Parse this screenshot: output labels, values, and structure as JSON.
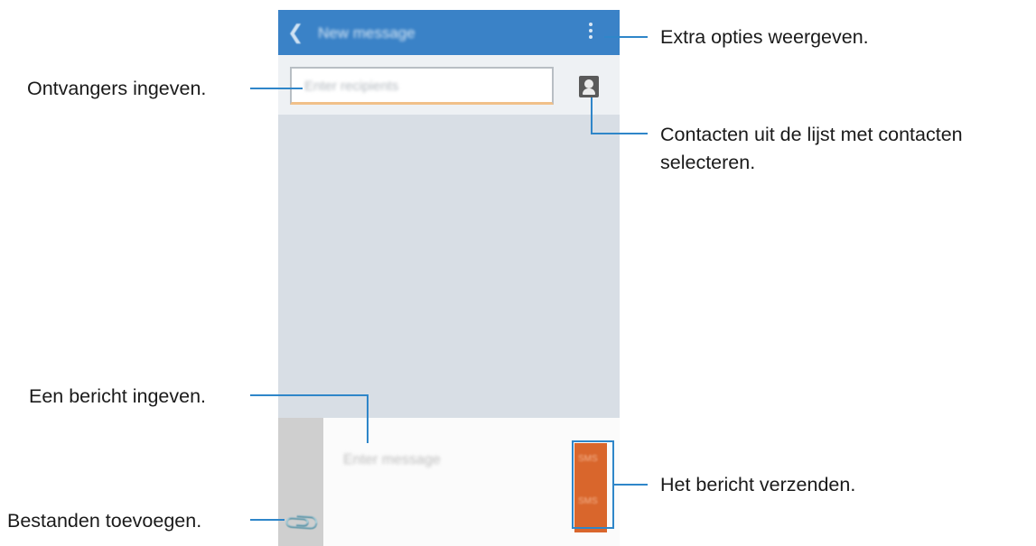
{
  "phone": {
    "app_title": "New message",
    "recipient_placeholder": "Enter recipients",
    "message_placeholder": "Enter message",
    "send_label": "SMS"
  },
  "callouts": {
    "extra_options": "Extra opties weergeven.",
    "recipients": "Ontvangers ingeven.",
    "contacts_line1": "Contacten uit de lijst met contacten",
    "contacts_line2": "selecteren.",
    "message": "Een bericht ingeven.",
    "send": "Het bericht verzenden.",
    "attach": "Bestanden toevoegen."
  },
  "colors": {
    "appbar": "#3a82c7",
    "callout_line": "#2f86c9",
    "send_button": "#d9662c"
  },
  "icons": [
    "back-arrow-icon",
    "more-options-icon",
    "contact-icon",
    "paperclip-icon",
    "send-icon"
  ]
}
